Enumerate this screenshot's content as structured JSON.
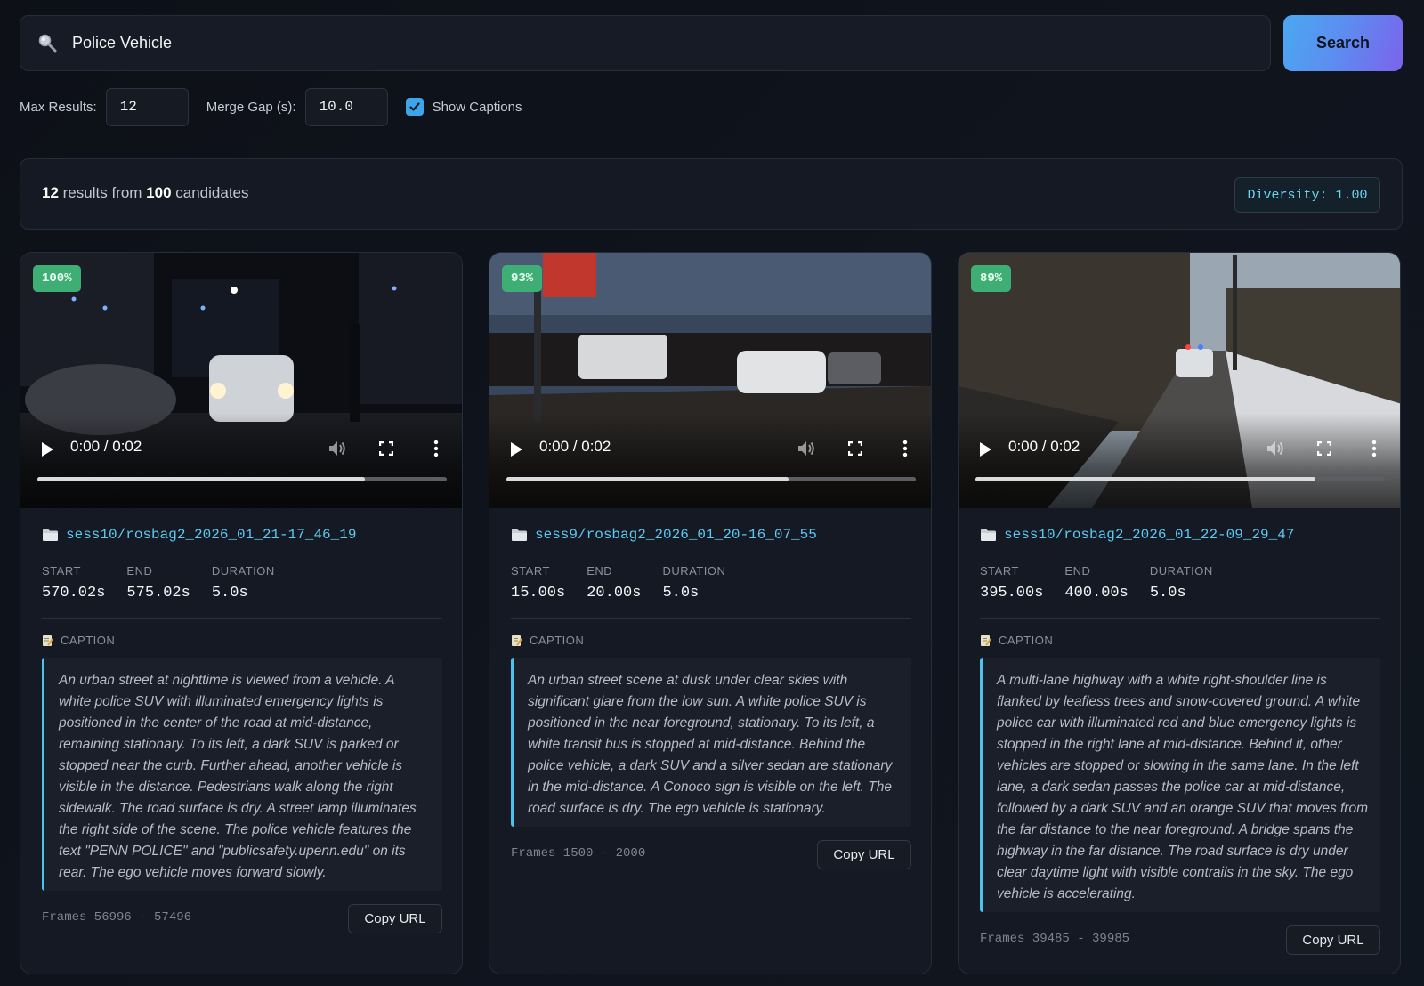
{
  "search": {
    "query": "Police Vehicle",
    "button_label": "Search"
  },
  "controls": {
    "max_results_label": "Max Results:",
    "max_results_value": "12",
    "merge_gap_label": "Merge Gap (s):",
    "merge_gap_value": "10.0",
    "show_captions_label": "Show Captions",
    "show_captions_checked": true
  },
  "summary": {
    "count": "12",
    "mid_text": " results from ",
    "candidates": "100",
    "end_text": " candidates",
    "diversity": "Diversity: 1.00"
  },
  "labels": {
    "start": "START",
    "end": "END",
    "duration": "DURATION",
    "caption": "CAPTION",
    "copy_url": "Copy URL"
  },
  "results": [
    {
      "score": "100%",
      "time": "0:00 / 0:02",
      "progress": 0.8,
      "session": "sess10/rosbag2_2026_01_21-17_46_19",
      "start": "570.02s",
      "end": "575.02s",
      "duration": "5.0s",
      "caption": "An urban street at nighttime is viewed from a vehicle. A white police SUV with illuminated emergency lights is positioned in the center of the road at mid-distance, remaining stationary. To its left, a dark SUV is parked or stopped near the curb. Further ahead, another vehicle is visible in the distance. Pedestrians walk along the right sidewalk. The road surface is dry. A street lamp illuminates the right side of the scene. The police vehicle features the text \"PENN POLICE\" and \"publicsafety.upenn.edu\" on its rear. The ego vehicle moves forward slowly.",
      "frames": "Frames 56996 - 57496",
      "scene": "night"
    },
    {
      "score": "93%",
      "time": "0:00 / 0:02",
      "progress": 0.69,
      "session": "sess9/rosbag2_2026_01_20-16_07_55",
      "start": "15.00s",
      "end": "20.00s",
      "duration": "5.0s",
      "caption": "An urban street scene at dusk under clear skies with significant glare from the low sun. A white police SUV is positioned in the near foreground, stationary. To its left, a white transit bus is stopped at mid-distance. Behind the police vehicle, a dark SUV and a silver sedan are stationary in the mid-distance. A Conoco sign is visible on the left. The road surface is dry. The ego vehicle is stationary.",
      "frames": "Frames 1500 - 2000",
      "scene": "dusk"
    },
    {
      "score": "89%",
      "time": "0:00 / 0:02",
      "progress": 0.83,
      "session": "sess10/rosbag2_2026_01_22-09_29_47",
      "start": "395.00s",
      "end": "400.00s",
      "duration": "5.0s",
      "caption": "A multi-lane highway with a white right-shoulder line is flanked by leafless trees and snow-covered ground. A white police car with illuminated red and blue emergency lights is stopped in the right lane at mid-distance. Behind it, other vehicles are stopped or slowing in the same lane. In the left lane, a dark sedan passes the police car at mid-distance, followed by a dark SUV and an orange SUV that moves from the far distance to the near foreground. A bridge spans the highway in the far distance. The road surface is dry under clear daytime light with visible contrails in the sky. The ego vehicle is accelerating.",
      "frames": "Frames 39485 - 39985",
      "scene": "day"
    }
  ],
  "colors": {
    "accent": "#4cc3ec",
    "score_badge": "#3fae75",
    "search_gradient_start": "#4aa8f2",
    "search_gradient_end": "#7b63ec"
  },
  "icons": [
    "search-icon",
    "checkbox-check-icon",
    "play-icon",
    "volume-icon",
    "fullscreen-icon",
    "more-vert-icon",
    "folder-icon",
    "memo-icon"
  ]
}
